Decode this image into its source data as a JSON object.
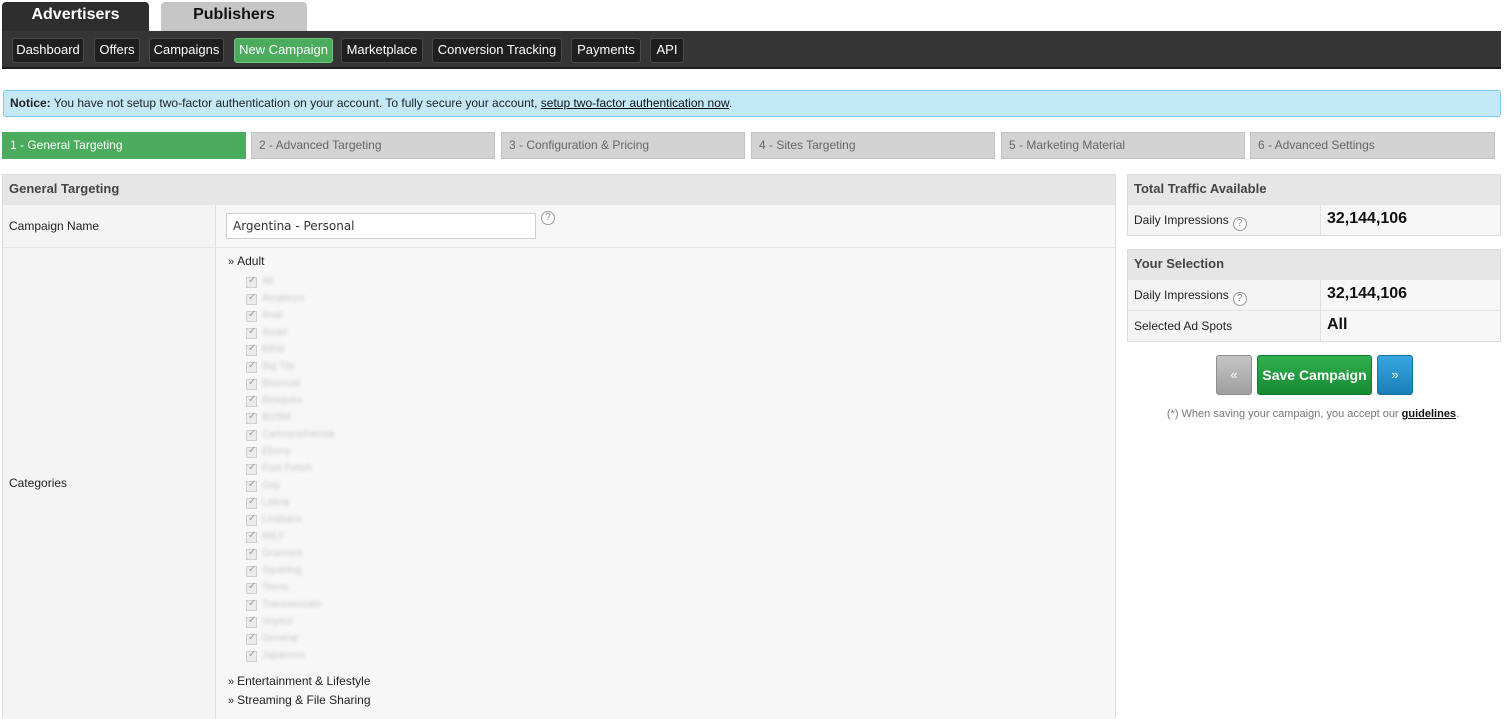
{
  "top_tabs": {
    "advertisers": "Advertisers",
    "publishers": "Publishers"
  },
  "nav": [
    "Dashboard",
    "Offers",
    "Campaigns",
    "New Campaign",
    "Marketplace",
    "Conversion Tracking",
    "Payments",
    "API"
  ],
  "nav_active": "New Campaign",
  "notice": {
    "label": "Notice:",
    "text": " You have not setup two-factor authentication on your account. To fully secure your account, ",
    "link": "setup two-factor authentication now",
    "tail": "."
  },
  "steps": [
    "1 - General Targeting",
    "2 - Advanced Targeting",
    "3 - Configuration & Pricing",
    "4 - Sites Targeting",
    "5 - Marketing Material",
    "6 - Advanced Settings"
  ],
  "form": {
    "section_title": "General Targeting",
    "campaign_name_label": "Campaign Name",
    "campaign_name_value": "Argentina - Personal",
    "help": "?",
    "categories_label": "Categories",
    "arrow": "»",
    "groups": [
      "Adult",
      "Entertainment & Lifestyle",
      "Streaming & File Sharing"
    ],
    "adult_subcategories": [
      "All",
      "Amateurs",
      "Anal",
      "Asian",
      "BBW",
      "Big Tits",
      "Bisexual",
      "Blowjobs",
      "BDSM",
      "Cartoons/Hentai",
      "Ebony",
      "Foot Fetish",
      "Gay",
      "Latina",
      "Lesbians",
      "MILF",
      "Grannies",
      "Squirting",
      "Teens",
      "Transsexuals",
      "Voyeur",
      "General",
      "Japanese"
    ]
  },
  "traffic": {
    "title": "Total Traffic Available",
    "daily_label": "Daily Impressions",
    "daily_value": "32,144,106"
  },
  "selection": {
    "title": "Your Selection",
    "daily_label": "Daily Impressions",
    "daily_value": "32,144,106",
    "spots_label": "Selected Ad Spots",
    "spots_value": "All"
  },
  "actions": {
    "prev": "«",
    "save": "Save Campaign",
    "next": "»",
    "note_text": "(*) When saving your campaign, you accept our ",
    "note_link": "guidelines",
    "note_tail": "."
  }
}
